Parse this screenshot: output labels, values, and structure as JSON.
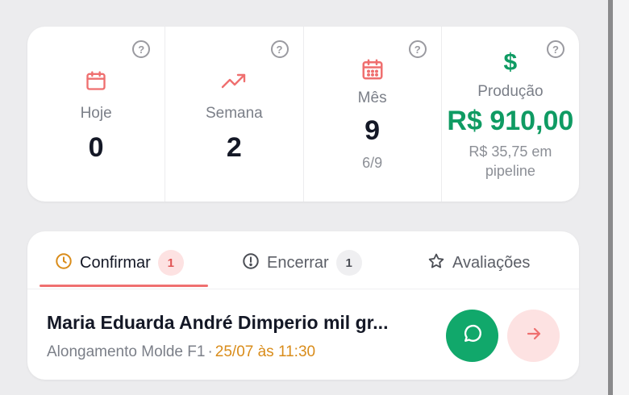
{
  "stats": [
    {
      "label": "Hoje",
      "value": "0",
      "icon": "calendar-icon",
      "help": "?"
    },
    {
      "label": "Semana",
      "value": "2",
      "icon": "trending-up-icon",
      "help": "?"
    },
    {
      "label": "Mês",
      "value": "9",
      "sub": "6/9",
      "icon": "calendar-grid-icon",
      "help": "?"
    },
    {
      "label": "Produção",
      "value": "R$ 910,00",
      "sub": "R$ 35,75 em pipeline",
      "icon": "$",
      "help": "?"
    }
  ],
  "tabs": [
    {
      "label": "Confirmar",
      "badge": "1",
      "icon": "clock-icon",
      "active": true
    },
    {
      "label": "Encerrar",
      "badge": "1",
      "icon": "alert-circle-icon"
    },
    {
      "label": "Avaliações",
      "icon": "star-icon"
    }
  ],
  "appointment": {
    "name": "Maria Eduarda André Dimperio mil gr...",
    "service": "Alongamento Molde F1",
    "separator": "·",
    "when": "25/07 às 11:30"
  },
  "colors": {
    "accent_red": "#ef6f6f",
    "green": "#0f9b63",
    "amber": "#d98c1a"
  }
}
